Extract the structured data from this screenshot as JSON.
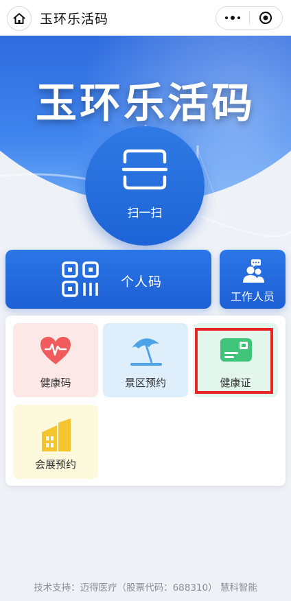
{
  "header": {
    "title": "玉环乐活码"
  },
  "banner": {
    "title": "玉环乐活码",
    "scan_label": "扫一扫"
  },
  "actions": {
    "personal_code_label": "个人码",
    "staff_label": "工作人员"
  },
  "services": [
    {
      "label": "健康码",
      "icon": "heart-pulse-icon"
    },
    {
      "label": "景区预约",
      "icon": "beach-umbrella-icon"
    },
    {
      "label": "健康证",
      "icon": "id-card-icon"
    },
    {
      "label": "会展预约",
      "icon": "building-icon"
    }
  ],
  "footer": {
    "text": "技术支持：迈得医疗（股票代码：688310） 慧科智能"
  },
  "colors": {
    "primary_blue": "#1d64d6",
    "highlight_red": "#e62525",
    "health_red": "#f15b5b",
    "scenic_blue": "#4ea3e8",
    "cert_green": "#3fc47a",
    "expo_yellow": "#f5c530"
  }
}
